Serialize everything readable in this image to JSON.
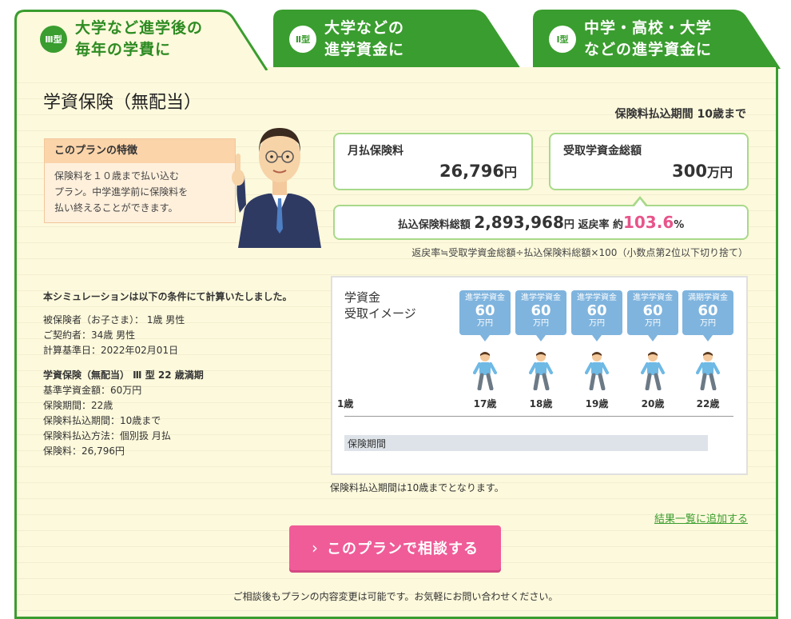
{
  "tabs": [
    {
      "badge": "Ⅲ型",
      "title": "大学など進学後の\n毎年の学費に",
      "active": true
    },
    {
      "badge": "Ⅱ型",
      "title": "大学などの\n進学資金に",
      "active": false
    },
    {
      "badge": "Ⅰ型",
      "title": "中学・高校・大学\nなどの進学資金に",
      "active": false
    }
  ],
  "plan": {
    "title": "学資保険（無配当）",
    "pay_period": "保険料払込期間 10歳まで"
  },
  "feature": {
    "heading": "このプランの特徴",
    "text": "保険料を１０歳まで払い込む\nプラン。中学進学前に保険料を\n払い終えることができます。"
  },
  "cards": {
    "monthly_label": "月払保険料",
    "monthly_value": "26,796",
    "total_label": "受取学資金総額",
    "total_value": "300",
    "yen": "円",
    "man_yen": "万円"
  },
  "summary": {
    "label": "払込保険料総額",
    "amount": "2,893,968",
    "yen": "円",
    "rate_label": "返戻率 約",
    "rate": "103.6",
    "pct": "%",
    "formula": "返戻率≒受取学資金総額÷払込保険料総額×100（小数点第2位以下切り捨て）"
  },
  "conditions": {
    "heading": "本シミュレーションは以下の条件にて計算いたしました。",
    "lines1": [
      "被保険者（お子さま）： 1歳 男性",
      "ご契約者：34歳 男性",
      "計算基準日：2022年02月01日"
    ],
    "section": "学資保険（無配当） Ⅲ 型 22 歳満期",
    "lines2": [
      "基準学資金額：60万円",
      "保険期間：22歳",
      "保険料払込期間：10歳まで",
      "保険料払込方法：個別扱 月払",
      "保険料：26,796円"
    ]
  },
  "image_panel": {
    "title": "学資金\n受取イメージ",
    "start_age": "1歳",
    "bubbles": [
      {
        "kind": "進学学資金",
        "amount": "60",
        "unit": "万円",
        "age": "17歳"
      },
      {
        "kind": "進学学資金",
        "amount": "60",
        "unit": "万円",
        "age": "18歳"
      },
      {
        "kind": "進学学資金",
        "amount": "60",
        "unit": "万円",
        "age": "19歳"
      },
      {
        "kind": "進学学資金",
        "amount": "60",
        "unit": "万円",
        "age": "20歳"
      },
      {
        "kind": "満期学資金",
        "amount": "60",
        "unit": "万円",
        "age": "22歳"
      }
    ],
    "period_label": "保険期間",
    "note": "保険料払込期間は10歳までとなります。"
  },
  "actions": {
    "add_link": "結果一覧に追加する",
    "consult_button": "このプランで相談する",
    "footer_note": "ご相談後もプランの内容変更は可能です。お気軽にお問い合わせください。"
  },
  "colors": {
    "green": "#3a9d2f",
    "pink": "#ef5c98",
    "panel_bg": "#fdf9dc",
    "bubble": "#7fb4de"
  }
}
